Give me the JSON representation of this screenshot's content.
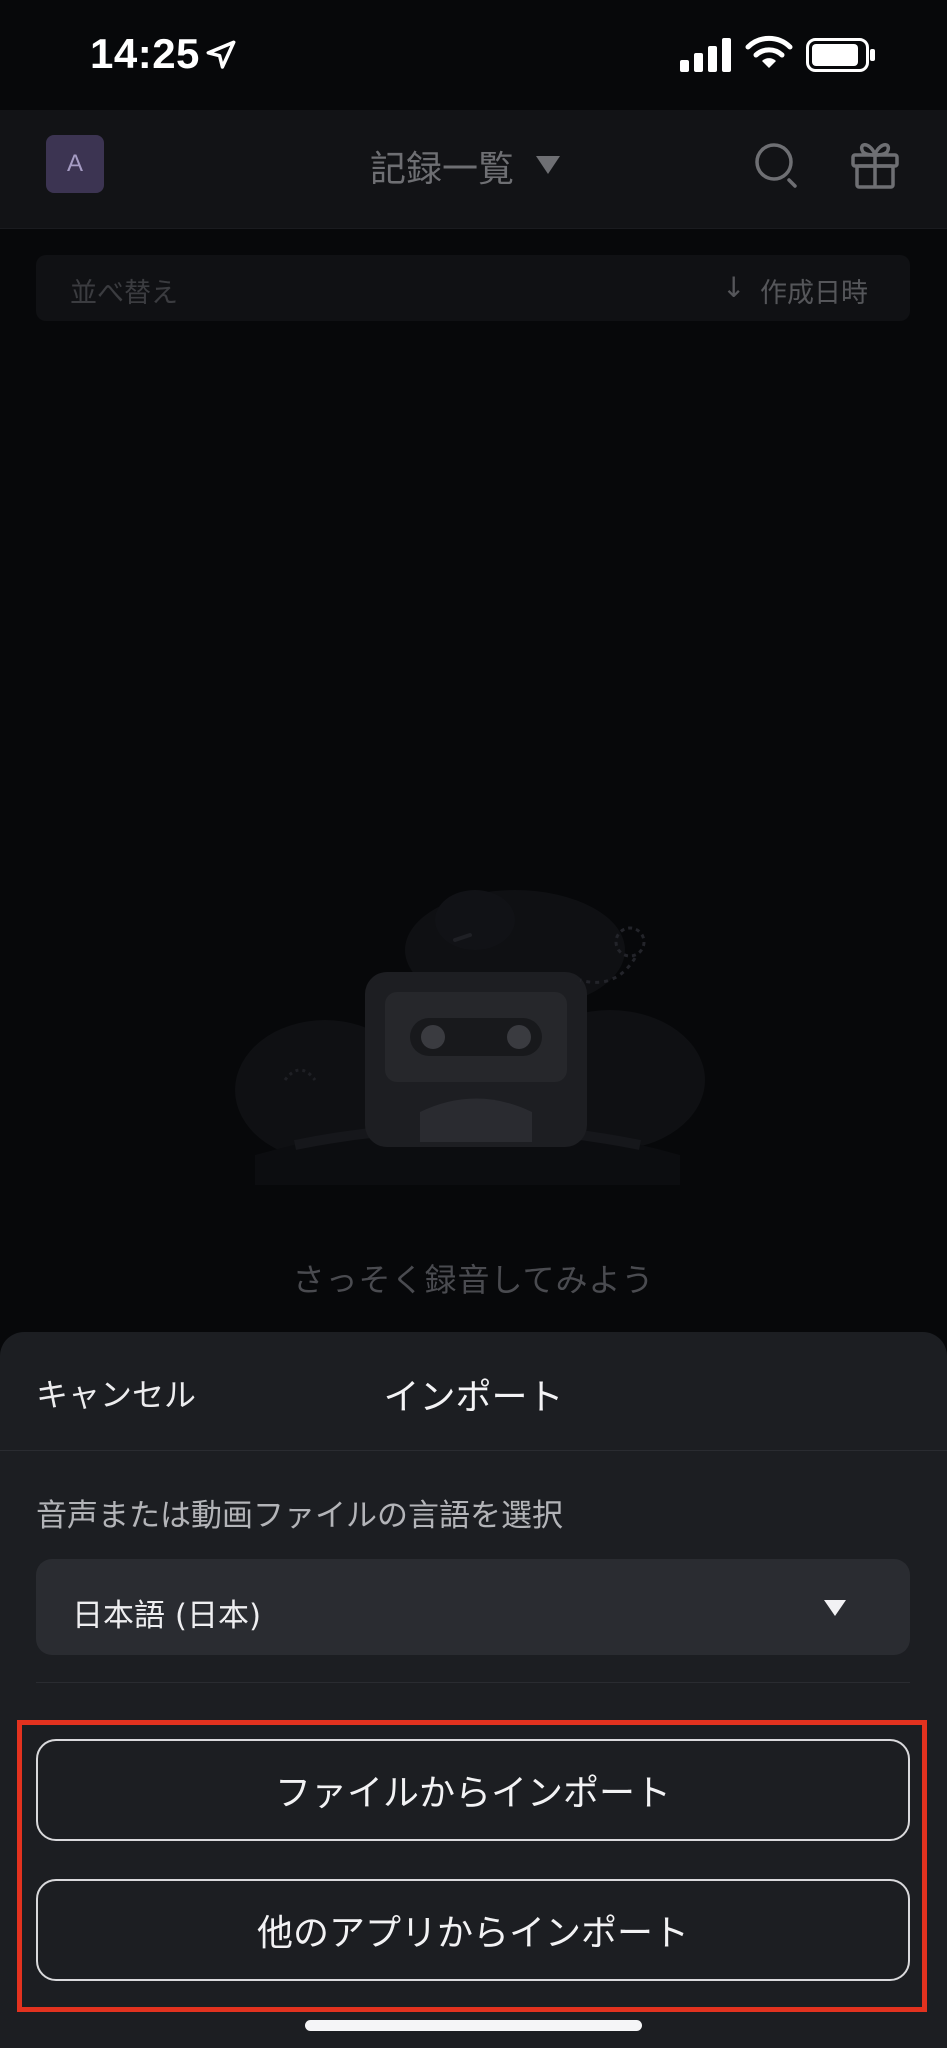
{
  "status_bar": {
    "time": "14:25",
    "icons": [
      "location-arrow-icon",
      "cell-signal-icon",
      "wifi-icon",
      "battery-icon"
    ]
  },
  "header": {
    "avatar_letter": "A",
    "title": "記録一覧",
    "icons": [
      "caret-down-icon",
      "search-icon",
      "gift-icon"
    ]
  },
  "sort_bar": {
    "label": "並べ替え",
    "arrow": "↓",
    "value": "作成日時"
  },
  "empty_state": {
    "message": "さっそく録音してみよう"
  },
  "import_sheet": {
    "cancel_label": "キャンセル",
    "title": "インポート",
    "language_prompt": "音声または動画ファイルの言語を選択",
    "language_selected": "日本語 (日本)",
    "import_from_file_label": "ファイルからインポート",
    "import_from_other_app_label": "他のアプリからインポート"
  },
  "colors": {
    "sheet_background": "#1c1e22",
    "highlight_border": "#e2321f",
    "avatar_background": "#3c3452"
  }
}
